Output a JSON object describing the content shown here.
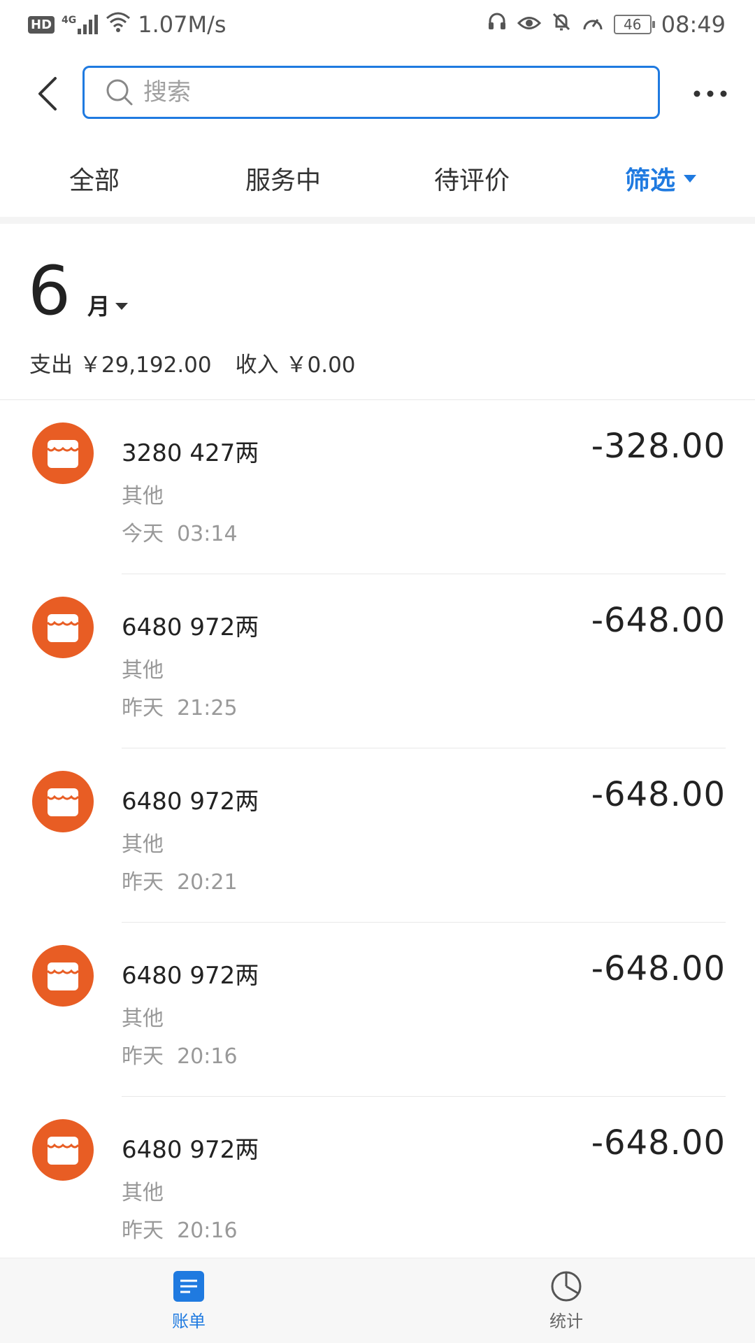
{
  "status": {
    "network_speed": "1.07M/s",
    "signal_label": "4G",
    "hd_label": "HD",
    "battery": "46",
    "time": "08:49"
  },
  "search": {
    "placeholder": "搜索",
    "value": ""
  },
  "tabs": [
    {
      "label": "全部",
      "active": false
    },
    {
      "label": "服务中",
      "active": false
    },
    {
      "label": "待评价",
      "active": false
    },
    {
      "label": "筛选",
      "active": true
    }
  ],
  "month": {
    "number": "6",
    "unit": "月",
    "expense_label": "支出",
    "expense_value": "￥29,192.00",
    "income_label": "收入",
    "income_value": "￥0.00"
  },
  "transactions": [
    {
      "title": "3280 427两",
      "category": "其他",
      "day": "今天",
      "time": "03:14",
      "amount": "-328.00",
      "icon": "store-icon"
    },
    {
      "title": "6480 972两",
      "category": "其他",
      "day": "昨天",
      "time": "21:25",
      "amount": "-648.00",
      "icon": "store-icon"
    },
    {
      "title": "6480 972两",
      "category": "其他",
      "day": "昨天",
      "time": "20:21",
      "amount": "-648.00",
      "icon": "store-icon"
    },
    {
      "title": "6480 972两",
      "category": "其他",
      "day": "昨天",
      "time": "20:16",
      "amount": "-648.00",
      "icon": "store-icon"
    },
    {
      "title": "6480 972两",
      "category": "其他",
      "day": "昨天",
      "time": "20:16",
      "amount": "-648.00",
      "icon": "store-icon"
    }
  ],
  "bottom_nav": [
    {
      "label": "账单",
      "active": true,
      "icon": "bill-icon"
    },
    {
      "label": "统计",
      "active": false,
      "icon": "pie-chart-icon"
    }
  ],
  "colors": {
    "accent": "#1f7ae0",
    "store_icon": "#e85d24"
  }
}
